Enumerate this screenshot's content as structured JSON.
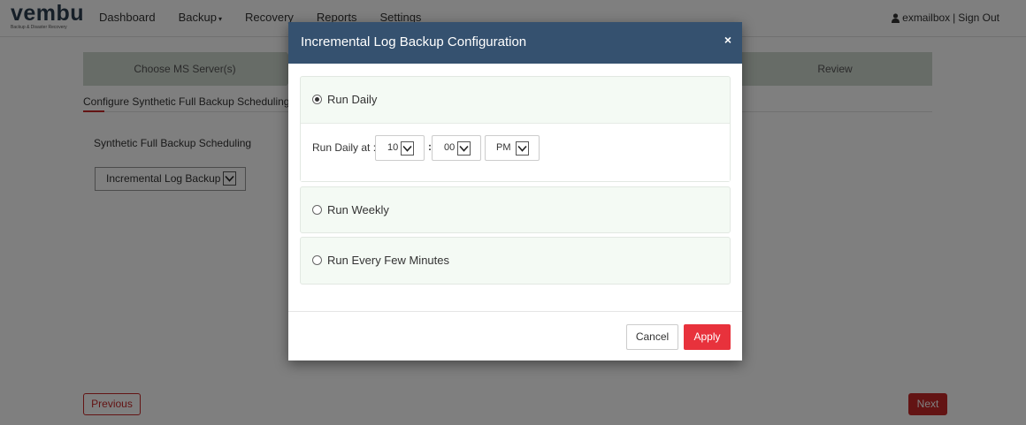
{
  "brand": {
    "logo_text": "vembu",
    "tagline": "Backup & Disaster Recovery"
  },
  "nav": {
    "items": [
      {
        "label": "Dashboard",
        "has_caret": false
      },
      {
        "label": "Backup",
        "has_caret": true
      },
      {
        "label": "Recovery",
        "has_caret": false
      },
      {
        "label": "Reports",
        "has_caret": false
      },
      {
        "label": "Settings",
        "has_caret": false
      }
    ],
    "caret_glyph": "▾"
  },
  "user": {
    "icon": "user-icon",
    "username": "exmailbox",
    "separator": "|",
    "sign_out": "Sign Out"
  },
  "wizard": {
    "steps": [
      {
        "label": "Choose MS Server(s)"
      },
      {
        "label": "Review"
      }
    ]
  },
  "page": {
    "subtitle": "Configure Synthetic Full Backup Scheduling",
    "field_label": "Synthetic Full Backup Scheduling",
    "field_value": "Incremental Log Backup",
    "previous_label": "Previous",
    "next_label": "Next"
  },
  "modal": {
    "title": "Incremental Log Backup Configuration",
    "close_glyph": "×",
    "options": {
      "daily": {
        "label": "Run Daily",
        "selected": true
      },
      "weekly": {
        "label": "Run Weekly",
        "selected": false
      },
      "minutes": {
        "label": "Run Every Few Minutes",
        "selected": false
      }
    },
    "daily_time": {
      "label": "Run Daily at :",
      "hour": "10",
      "colon": ":",
      "minute": "00",
      "ampm": "PM"
    },
    "cancel_label": "Cancel",
    "apply_label": "Apply"
  },
  "colors": {
    "modal_header": "#35516f",
    "accent_red": "#e8323c",
    "wizard_step": "#cfd8cf",
    "panel_bg": "#f4faf4"
  }
}
